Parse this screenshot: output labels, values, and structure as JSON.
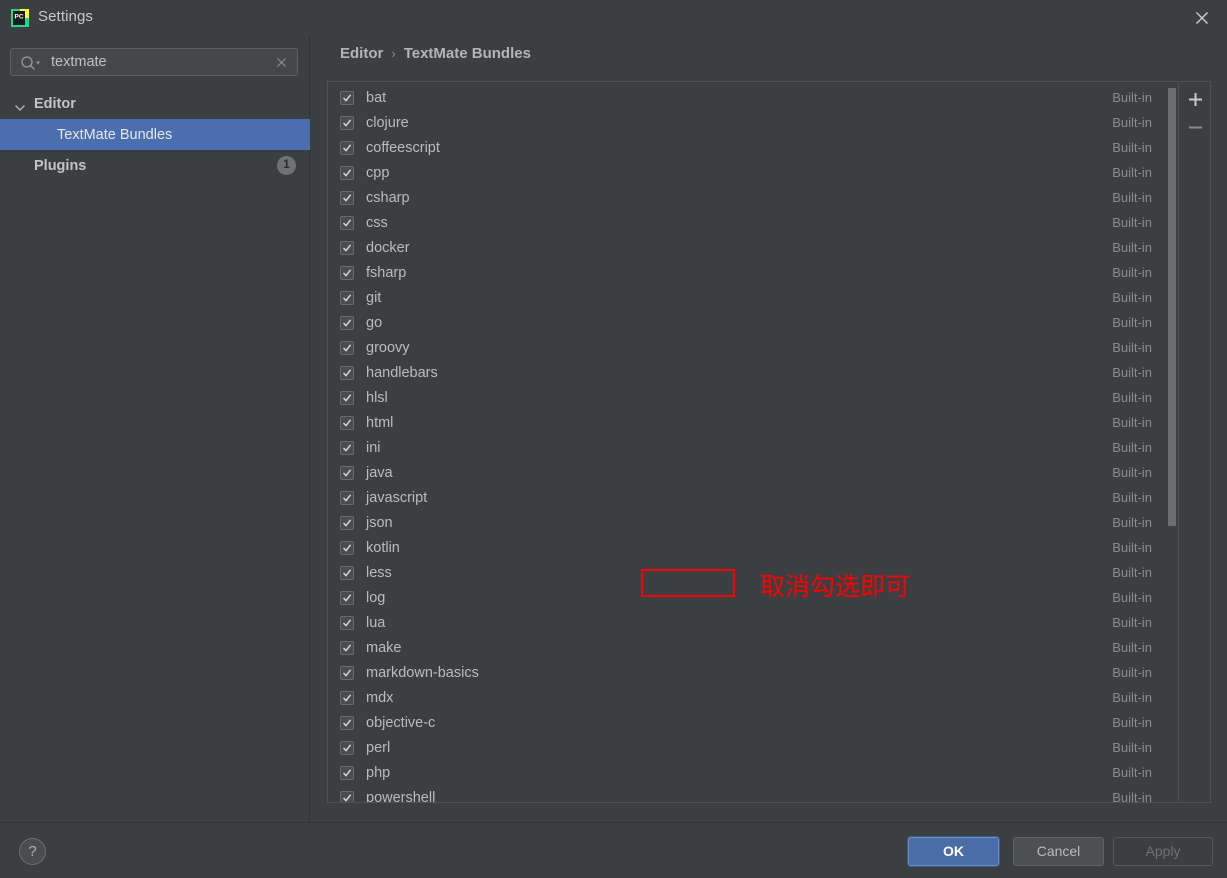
{
  "window": {
    "title": "Settings",
    "app_icon": "pycharm-logo",
    "close_icon": "close-icon"
  },
  "search": {
    "value": "textmate",
    "placeholder": "",
    "search_icon": "search-icon",
    "clear_icon": "clear-icon"
  },
  "sidebar": {
    "items": [
      {
        "label": "Editor",
        "level": 0,
        "expanded": true,
        "selected": false,
        "badge": null
      },
      {
        "label": "TextMate Bundles",
        "level": 1,
        "expanded": false,
        "selected": true,
        "badge": null
      },
      {
        "label": "Plugins",
        "level": 0,
        "expanded": false,
        "selected": false,
        "badge": "1"
      }
    ]
  },
  "breadcrumb": {
    "parts": [
      "Editor",
      "TextMate Bundles"
    ],
    "separator": "›"
  },
  "bundles": {
    "tag_label": "Built-in",
    "items": [
      {
        "name": "bat",
        "checked": true,
        "tag": "Built-in"
      },
      {
        "name": "clojure",
        "checked": true,
        "tag": "Built-in"
      },
      {
        "name": "coffeescript",
        "checked": true,
        "tag": "Built-in"
      },
      {
        "name": "cpp",
        "checked": true,
        "tag": "Built-in"
      },
      {
        "name": "csharp",
        "checked": true,
        "tag": "Built-in"
      },
      {
        "name": "css",
        "checked": true,
        "tag": "Built-in"
      },
      {
        "name": "docker",
        "checked": true,
        "tag": "Built-in"
      },
      {
        "name": "fsharp",
        "checked": true,
        "tag": "Built-in"
      },
      {
        "name": "git",
        "checked": true,
        "tag": "Built-in"
      },
      {
        "name": "go",
        "checked": true,
        "tag": "Built-in"
      },
      {
        "name": "groovy",
        "checked": true,
        "tag": "Built-in"
      },
      {
        "name": "handlebars",
        "checked": true,
        "tag": "Built-in"
      },
      {
        "name": "hlsl",
        "checked": true,
        "tag": "Built-in"
      },
      {
        "name": "html",
        "checked": true,
        "tag": "Built-in"
      },
      {
        "name": "ini",
        "checked": true,
        "tag": "Built-in"
      },
      {
        "name": "java",
        "checked": true,
        "tag": "Built-in"
      },
      {
        "name": "javascript",
        "checked": true,
        "tag": "Built-in"
      },
      {
        "name": "json",
        "checked": true,
        "tag": "Built-in"
      },
      {
        "name": "kotlin",
        "checked": true,
        "tag": "Built-in"
      },
      {
        "name": "less",
        "checked": true,
        "tag": "Built-in"
      },
      {
        "name": "log",
        "checked": true,
        "tag": "Built-in"
      },
      {
        "name": "lua",
        "checked": true,
        "tag": "Built-in"
      },
      {
        "name": "make",
        "checked": true,
        "tag": "Built-in"
      },
      {
        "name": "markdown-basics",
        "checked": true,
        "tag": "Built-in"
      },
      {
        "name": "mdx",
        "checked": true,
        "tag": "Built-in"
      },
      {
        "name": "objective-c",
        "checked": true,
        "tag": "Built-in"
      },
      {
        "name": "perl",
        "checked": true,
        "tag": "Built-in"
      },
      {
        "name": "php",
        "checked": true,
        "tag": "Built-in"
      },
      {
        "name": "powershell",
        "checked": true,
        "tag": "Built-in"
      }
    ]
  },
  "list_tools": {
    "add_label": "+",
    "remove_label": "−"
  },
  "annotation": {
    "text": "取消勾选即可",
    "color": "#ff0000",
    "target_row": "kotlin"
  },
  "footer": {
    "help_label": "?",
    "ok_label": "OK",
    "cancel_label": "Cancel",
    "apply_label": "Apply",
    "apply_enabled": false
  }
}
